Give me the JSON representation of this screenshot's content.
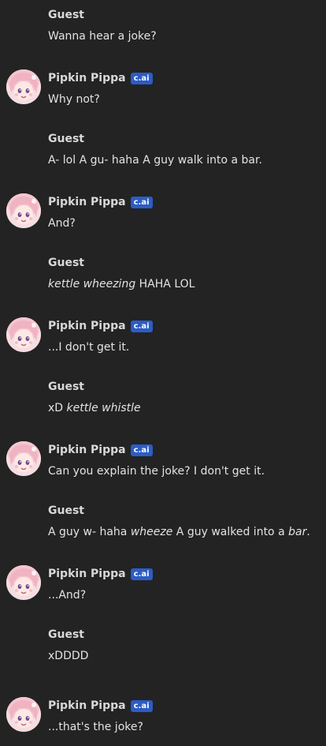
{
  "messages": [
    {
      "sender": "Guest",
      "bot": false,
      "parts": [
        {
          "t": "Wanna hear a joke?",
          "i": false
        }
      ]
    },
    {
      "sender": "Pipkin Pippa",
      "bot": true,
      "badge": "c.ai",
      "parts": [
        {
          "t": "Why not?",
          "i": false
        }
      ]
    },
    {
      "sender": "Guest",
      "bot": false,
      "parts": [
        {
          "t": "A- lol A gu- haha A guy walk into a bar.",
          "i": false
        }
      ]
    },
    {
      "sender": "Pipkin Pippa",
      "bot": true,
      "badge": "c.ai",
      "parts": [
        {
          "t": "And?",
          "i": false
        }
      ]
    },
    {
      "sender": "Guest",
      "bot": false,
      "parts": [
        {
          "t": "kettle wheezing",
          "i": true
        },
        {
          "t": " HAHA LOL",
          "i": false
        }
      ]
    },
    {
      "sender": "Pipkin Pippa",
      "bot": true,
      "badge": "c.ai",
      "parts": [
        {
          "t": "...I don't get it.",
          "i": false
        }
      ]
    },
    {
      "sender": "Guest",
      "bot": false,
      "parts": [
        {
          "t": "xD ",
          "i": false
        },
        {
          "t": "kettle whistle",
          "i": true
        }
      ]
    },
    {
      "sender": "Pipkin Pippa",
      "bot": true,
      "badge": "c.ai",
      "parts": [
        {
          "t": "Can you explain the joke? I don't get it.",
          "i": false
        }
      ]
    },
    {
      "sender": "Guest",
      "bot": false,
      "parts": [
        {
          "t": "A guy w- haha ",
          "i": false
        },
        {
          "t": "wheeze",
          "i": true
        },
        {
          "t": " A guy walked into a ",
          "i": false
        },
        {
          "t": "bar",
          "i": true
        },
        {
          "t": ".",
          "i": false
        }
      ]
    },
    {
      "sender": "Pipkin Pippa",
      "bot": true,
      "badge": "c.ai",
      "parts": [
        {
          "t": "...And?",
          "i": false
        }
      ]
    },
    {
      "sender": "Guest",
      "bot": false,
      "parts": [
        {
          "t": "xDDDD",
          "i": false
        }
      ]
    },
    {
      "sender": "Pipkin Pippa",
      "bot": true,
      "badge": "c.ai",
      "parts": [
        {
          "t": "...that's the joke?",
          "i": false
        }
      ]
    }
  ]
}
